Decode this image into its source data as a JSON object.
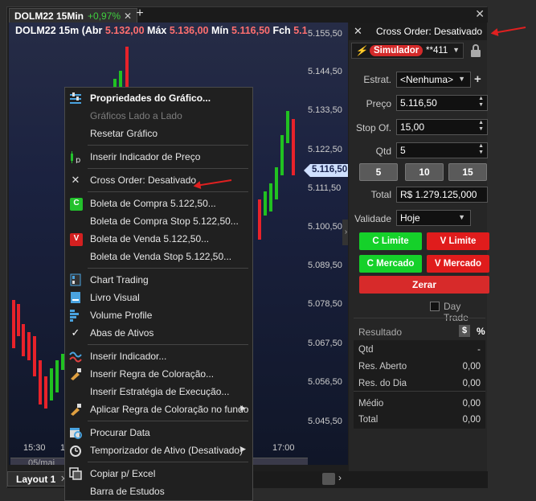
{
  "tab": {
    "name": "DOLM22 15Min",
    "change": "+0,97%",
    "close": "✕",
    "add": "+"
  },
  "window": {
    "close": "✕"
  },
  "chart": {
    "info_name": "DOLM22 15m",
    "abr_label": "(Abr",
    "abr_value": "5.132,00",
    "max_label": "Máx",
    "max_value": "5.136,00",
    "min_label": "Mín",
    "min_value": "5.116,50",
    "fch_label": "Fch",
    "fch_value": "5.1",
    "price_axis": [
      "5.155,50",
      "5.144,50",
      "5.133,50",
      "5.122,50",
      "5.111,50",
      "5.100,50",
      "5.089,50",
      "5.078,50",
      "5.067,50",
      "5.056,50",
      "5.045,50"
    ],
    "current_price": "5.116,50",
    "time_axis": [
      "15:30",
      "17:",
      "17:00"
    ],
    "date_label": "05/mai",
    "scroll_arrow": "›"
  },
  "bottom": {
    "layout_tab": "Layout 1",
    "layout_close": "✕",
    "next": "›"
  },
  "panel": {
    "title": "Cross Order: Desativado",
    "account_logo": "⚡",
    "simulator": "Simulador",
    "account_number": "**411",
    "estrat_label": "Estrat.",
    "estrat_value": "<Nenhuma>",
    "preco_label": "Preço",
    "preco_value": "5.116,50",
    "stop_label": "Stop Of.",
    "stop_value": "15,00",
    "qtd_label": "Qtd",
    "qtd_value": "5",
    "quick_qty": [
      "5",
      "10",
      "15"
    ],
    "total_label": "Total",
    "total_value": "R$ 1.279.125,000",
    "validade_label": "Validade",
    "validade_value": "Hoje",
    "c_limite": "C Limite",
    "v_limite": "V Limite",
    "c_mercado": "C Mercado",
    "v_mercado": "V Mercado",
    "zerar": "Zerar",
    "day_trade": "Day Trade",
    "resultado": "Resultado",
    "res_dollar": "$",
    "res_pct": "%",
    "rows": [
      {
        "label": "Qtd",
        "value": "-"
      },
      {
        "label": "Res. Aberto",
        "value": "0,00"
      },
      {
        "label": "Res. do Dia",
        "value": "0,00"
      },
      {
        "label": "Médio",
        "value": "0,00"
      },
      {
        "label": "Total",
        "value": "0,00"
      }
    ]
  },
  "menu": {
    "items": [
      {
        "label": "Propriedades do Gráfico...",
        "icon": "sliders-icon"
      },
      {
        "label": "Gráficos Lado a Lado",
        "icon": "none"
      },
      {
        "label": "Resetar Gráfico",
        "icon": "none"
      },
      {
        "label": "Inserir Indicador de Preço",
        "icon": "price-indicator-icon"
      },
      {
        "label": "Cross Order: Desativado",
        "icon": "cross-order-icon"
      },
      {
        "label": "Boleta de Compra  5.122,50...",
        "icon": "buy-icon",
        "icon_text": "C"
      },
      {
        "label": "Boleta de Compra Stop  5.122,50...",
        "icon": "none"
      },
      {
        "label": "Boleta de Venda  5.122,50...",
        "icon": "sell-icon",
        "icon_text": "V"
      },
      {
        "label": "Boleta de Venda Stop  5.122,50...",
        "icon": "none"
      },
      {
        "label": "Chart Trading",
        "icon": "chart-trading-icon"
      },
      {
        "label": "Livro Visual",
        "icon": "book-icon"
      },
      {
        "label": "Volume Profile",
        "icon": "volume-profile-icon"
      },
      {
        "label": "Abas de Ativos",
        "icon": "check-icon",
        "icon_text": "✓"
      },
      {
        "label": "Inserir Indicador...",
        "icon": "indicator-icon"
      },
      {
        "label": "Inserir Regra de Coloração...",
        "icon": "color-rule-icon"
      },
      {
        "label": "Inserir Estratégia de Execução...",
        "icon": "none"
      },
      {
        "label": "Aplicar Regra de Coloração no fundo",
        "icon": "color-bg-icon"
      },
      {
        "label": "Procurar Data",
        "icon": "calendar-icon"
      },
      {
        "label": "Temporizador de Ativo (Desativado)",
        "icon": "timer-icon"
      },
      {
        "label": "Copiar p/ Excel",
        "icon": "copy-icon"
      },
      {
        "label": "Barra de Estudos",
        "icon": "none"
      }
    ],
    "submenu_arrow": "▶"
  }
}
